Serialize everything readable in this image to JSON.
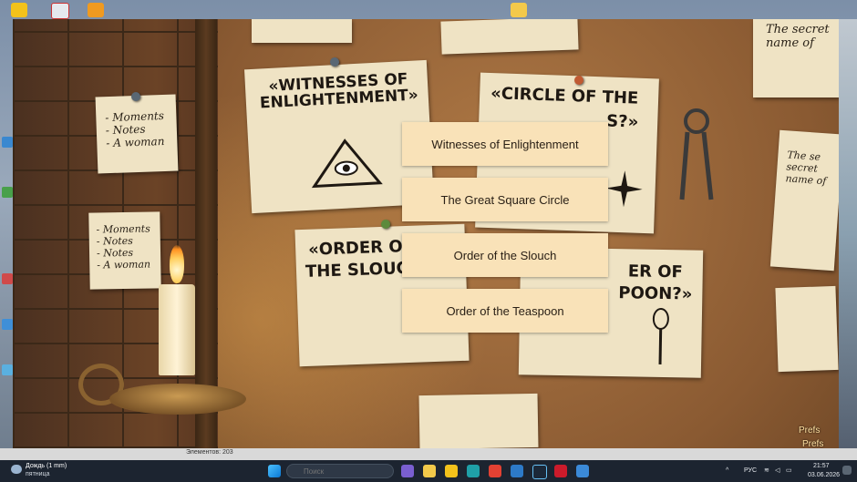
{
  "menu": {
    "items": [
      {
        "label": "Witnesses of Enlightenment"
      },
      {
        "label": "The Great Square Circle"
      },
      {
        "label": "Order of the Slouch"
      },
      {
        "label": "Order of the Teaspoon"
      }
    ]
  },
  "posters": {
    "witnesses_title": "«WITNESSES OF ENLIGHTENMENT»",
    "circle_title": "«CIRCLE OF THE",
    "circle_title2": "S?»",
    "order_slouch_title": "«ORDER O",
    "order_slouch_title2": "THE SLOUC",
    "order_teaspoon_title": "ER OF",
    "order_teaspoon_title2": "POON?»",
    "secret_note": "The secret\nname of",
    "secret_note2": "The se\nsecret\nname of"
  },
  "notes": {
    "note1": "- Moments\n- Notes\n- A woman",
    "note2": "- Moments\n- Notes\n- Notes\n- A woman"
  },
  "prefs": {
    "label1": "Prefs",
    "label2": "Prefs"
  },
  "status_strip": {
    "text": "Элементов: 203"
  },
  "taskbar": {
    "weather_text": "Дождь (1 mm)",
    "weather_day": "пятница",
    "search_placeholder": "Поиск",
    "language": "РУС",
    "time": "21:57",
    "date": "03.06.2026"
  },
  "colors": {
    "button_bg": "#f9e2b8",
    "button_text": "#2a2016",
    "taskbar_bg": "#1c2430"
  }
}
